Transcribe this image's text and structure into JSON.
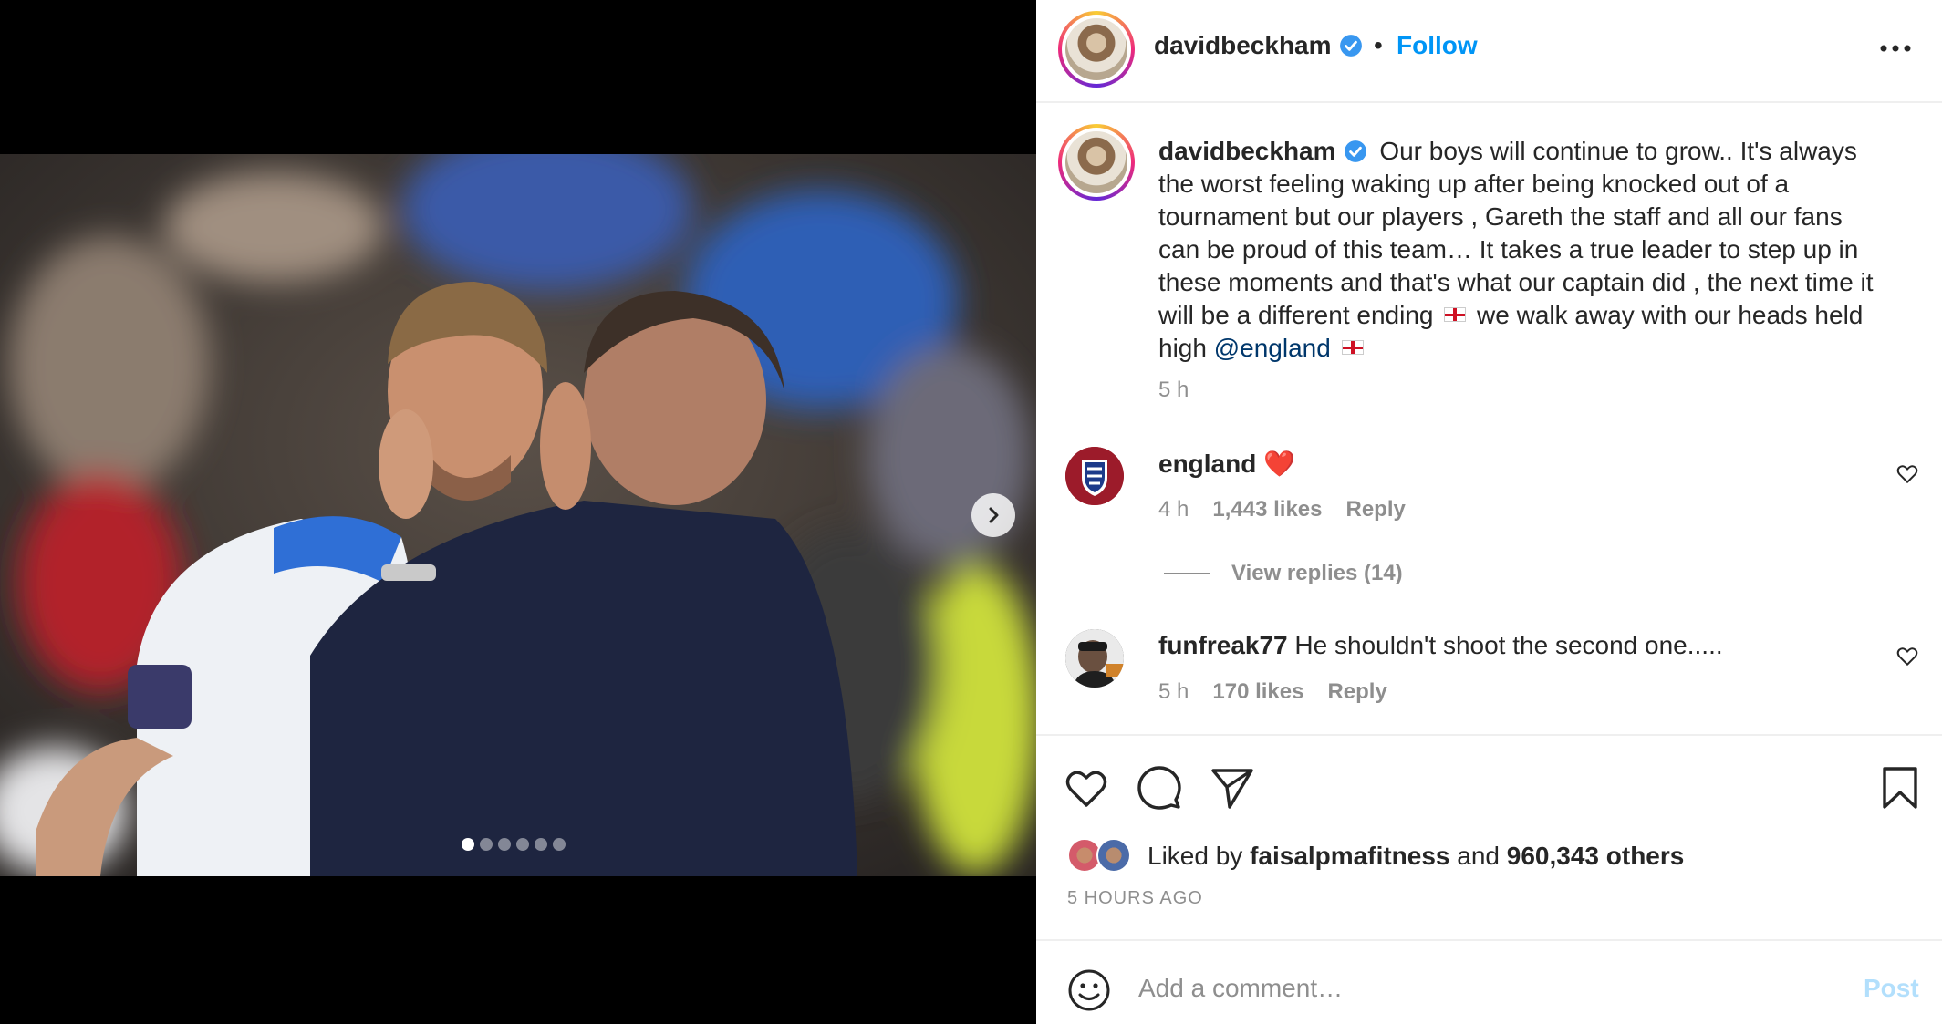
{
  "post": {
    "username": "davidbeckham",
    "verified": true,
    "follow_label": "Follow",
    "separator": "•",
    "caption_pre": "Our boys will continue to grow.. It's always the worst feeling waking up after being knocked out of a tournament but our players , Gareth the staff and all our fans can be proud of this team… It takes a true leader to step up in these moments and that's what our captain did , the next time it will be a different ending",
    "caption_mid": "we walk away with our heads held high",
    "caption_mention": "@england",
    "caption_time": "5 h",
    "carousel_total": 6,
    "carousel_active": 1
  },
  "comments": [
    {
      "username": "england",
      "text": "❤️",
      "time": "4 h",
      "likes": "1,443 likes",
      "reply_label": "Reply"
    },
    {
      "username": "funfreak77",
      "text": "He shouldn't shoot the second one.....",
      "time": "5 h",
      "likes": "170 likes",
      "reply_label": "Reply"
    }
  ],
  "view_replies": "View replies (14)",
  "likes": {
    "prefix": "Liked by",
    "user": "faisalpmafitness",
    "and": "and",
    "others": "960,343 others"
  },
  "posted_ago": "5 HOURS AGO",
  "add_comment": {
    "placeholder": "Add a comment…",
    "post_label": "Post"
  },
  "icons": [
    "more-icon",
    "verified-icon",
    "heart-icon",
    "comment-icon",
    "share-icon",
    "bookmark-icon",
    "emoji-icon",
    "chevron-right-icon"
  ],
  "colors": {
    "accent": "#0095f6",
    "text": "#262626",
    "muted": "#8e8e8e",
    "post_disabled": "#b2dffc"
  }
}
